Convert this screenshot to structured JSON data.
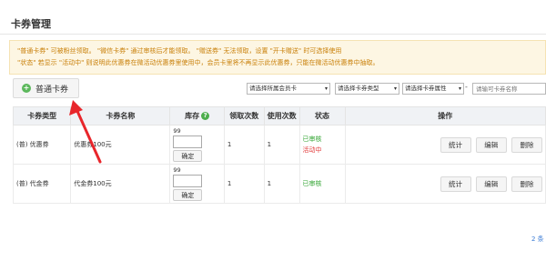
{
  "page": {
    "title": "卡券管理"
  },
  "notice": {
    "line1": "\"普通卡券\" 可被粉丝领取。 \"微信卡券\" 通过审核后才能领取。 \"赠送券\" 无法领取，设置 \"开卡赠送\" 时可选择使用",
    "line2": "\"状态\" 若显示 \"活动中\" 则说明此优惠券在微活动优惠券里使用中，会员卡里将不再显示此优惠券，只能在微活动优惠券中抽取。"
  },
  "toolbar": {
    "add_button": "普通卡券",
    "filters": [
      "请选择所属会员卡",
      "请选择卡券类型",
      "请选择卡券属性"
    ],
    "dash": "-",
    "search_placeholder": "请输可卡券名称"
  },
  "table": {
    "headers": [
      "卡券类型",
      "卡券名称",
      "库存",
      "领取次数",
      "使用次数",
      "状态",
      "操作"
    ],
    "rows": [
      {
        "type": "(普) 优惠券",
        "name": "优惠券100元",
        "stock": "99",
        "confirm": "确定",
        "received": "1",
        "used": "1",
        "status1": "已审核",
        "status2": "活动中"
      },
      {
        "type": "(普) 代金券",
        "name": "代金券100元",
        "stock": "99",
        "confirm": "确定",
        "received": "1",
        "used": "1",
        "status1": "已审核",
        "status2": ""
      }
    ],
    "actions": [
      "统计",
      "编辑",
      "删除"
    ]
  },
  "pager": {
    "text": "2 条"
  },
  "icons": {
    "add": "plus-circle-icon",
    "help": "question-circle-icon",
    "arrow": "red-arrow-annotation"
  },
  "colors": {
    "notice_text": "#c9800a",
    "approved": "#2fa32f",
    "active": "#e23b3b",
    "arrow": "#e8262b"
  }
}
